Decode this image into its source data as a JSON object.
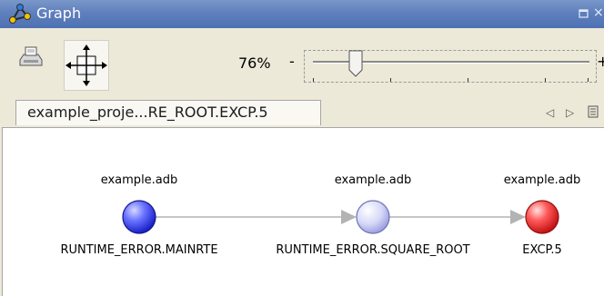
{
  "window": {
    "title": "Graph"
  },
  "toolbar": {
    "print_icon": "print-icon",
    "fit_icon": "fit-to-window-icon",
    "zoom_label": "76%",
    "zoom_minus": "-",
    "zoom_plus": "+",
    "zoom_level_percent": 76
  },
  "tabs": [
    {
      "label": "example_proje...RE_ROOT.EXCP.5"
    }
  ],
  "graph": {
    "nodes": [
      {
        "file": "example.adb",
        "name": "RUNTIME_ERROR.MAINRTE",
        "color": "#3f4cf0"
      },
      {
        "file": "example.adb",
        "name": "RUNTIME_ERROR.SQUARE_ROOT",
        "color": "#c7c9f5"
      },
      {
        "file": "example.adb",
        "name": "EXCP.5",
        "color": "#e63333"
      }
    ],
    "edges": [
      {
        "from": 0,
        "to": 1
      },
      {
        "from": 1,
        "to": 2
      }
    ]
  },
  "colors": {
    "titlebar": "#5f80bd",
    "window_bg": "#ece9d8",
    "edge": "#b3b3b3"
  }
}
